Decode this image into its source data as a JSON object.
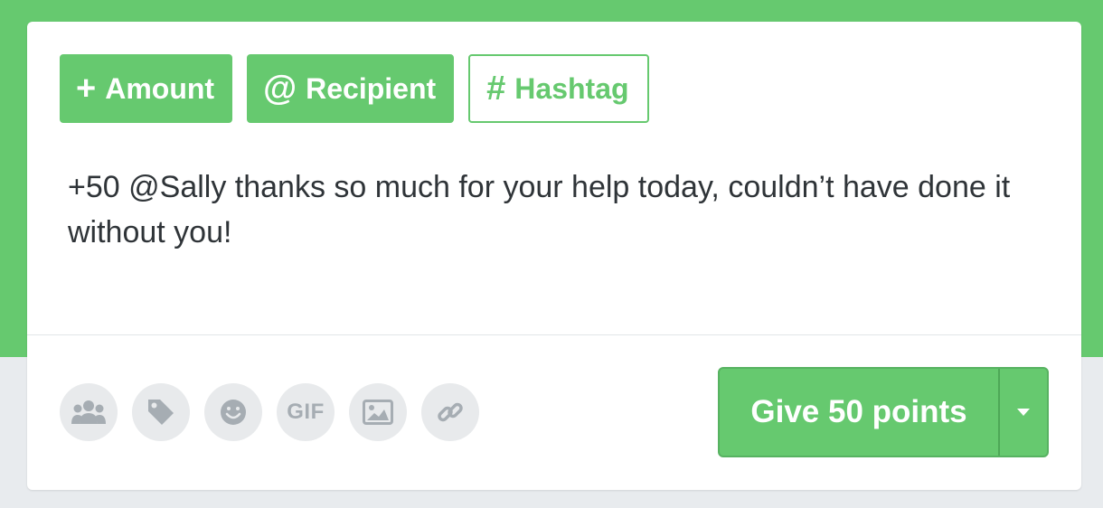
{
  "tag_buttons": {
    "amount": {
      "symbol": "+",
      "label": "Amount"
    },
    "recipient": {
      "symbol": "@",
      "label": "Recipient"
    },
    "hashtag": {
      "symbol": "#",
      "label": "Hashtag"
    }
  },
  "message": {
    "text": "+50 @Sally thanks so much for your help today, couldn’t have done it without you!"
  },
  "toolbar": {
    "gif_label": "GIF",
    "icons": [
      "group-icon",
      "tag-icon",
      "emoji-icon",
      "gif-icon",
      "image-icon",
      "link-icon"
    ]
  },
  "submit": {
    "label": "Give 50 points"
  },
  "colors": {
    "brand_green": "#66c96f",
    "icon_gray": "#a6adb3",
    "text_dark": "#2f3438",
    "page_bg": "#e8ebee"
  }
}
